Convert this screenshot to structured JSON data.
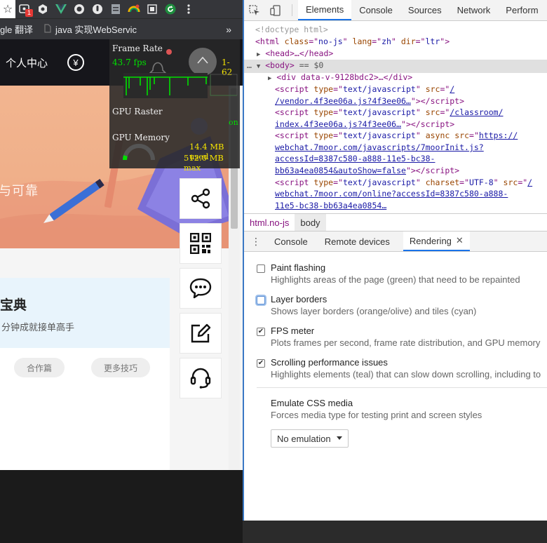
{
  "browser": {
    "bookmarks": [
      {
        "label": "gle 翻译"
      },
      {
        "label": "java 实现WebServic"
      }
    ],
    "ext_badge": "1",
    "more_label": "»"
  },
  "page": {
    "header_title": "个人中心",
    "yen_symbol": "¥",
    "banner_text": "与可靠",
    "card_title": "宝典",
    "card_subtitle": "分钟成就接单高手",
    "pills": [
      "合作篇",
      "更多技巧"
    ]
  },
  "fps_meter": {
    "frame_rate_label": "Frame Rate",
    "fps_value": "43.7 fps",
    "range": "1-62",
    "gpu_raster_label": "GPU Raster",
    "gpu_raster_state": "on",
    "gpu_memory_label": "GPU Memory",
    "memory_used": "14.4 MB used",
    "memory_max": "512.0 MB max",
    "memory_fraction": 0.028
  },
  "devtools": {
    "tabs": [
      "Elements",
      "Console",
      "Sources",
      "Network",
      "Perform"
    ],
    "active_tab": "Elements",
    "dom": {
      "doctype": "<!doctype html>",
      "html_open": "<html",
      "html_class": "no-js",
      "html_lang": "zh",
      "html_dir": "ltr",
      "head": "<head>…</head>",
      "body_open": "<body>",
      "body_sel": "== $0",
      "div_line": "<div data-v-9128bdc2>…</div>",
      "script1_src": "/vendor.4f3ee06a.js?4f3ee06…",
      "script2_src": "/classroom/index.4f3ee06a.js?4f3ee06…",
      "script3_src": "https://webchat.7moor.com/javascripts/7moorInit.js?accessId=8387c580-a888-11e5-bc38-bb63a4ea0854&autoShow=false",
      "script4_src": "/webchat.7moor.com/online?accessId=8387c580-a888-11e5-bc38-bb63a4ea0854…"
    },
    "breadcrumbs": [
      "html.no-js",
      "body"
    ],
    "drawer_tabs": [
      "Console",
      "Remote devices",
      "Rendering"
    ],
    "active_drawer_tab": "Rendering",
    "rendering_options": [
      {
        "title": "Paint flashing",
        "desc": "Highlights areas of the page (green) that need to be repainted",
        "checked": false
      },
      {
        "title": "Layer borders",
        "desc": "Shows layer borders (orange/olive) and tiles (cyan)",
        "checked": false
      },
      {
        "title": "FPS meter",
        "desc": "Plots frames per second, frame rate distribution, and GPU memory",
        "checked": true
      },
      {
        "title": "Scrolling performance issues",
        "desc": "Highlights elements (teal) that can slow down scrolling, including to",
        "checked": true
      }
    ],
    "emulate": {
      "title": "Emulate CSS media",
      "desc": "Forces media type for testing print and screen styles",
      "selected": "No emulation"
    },
    "accent_color": "#1a73e8"
  }
}
